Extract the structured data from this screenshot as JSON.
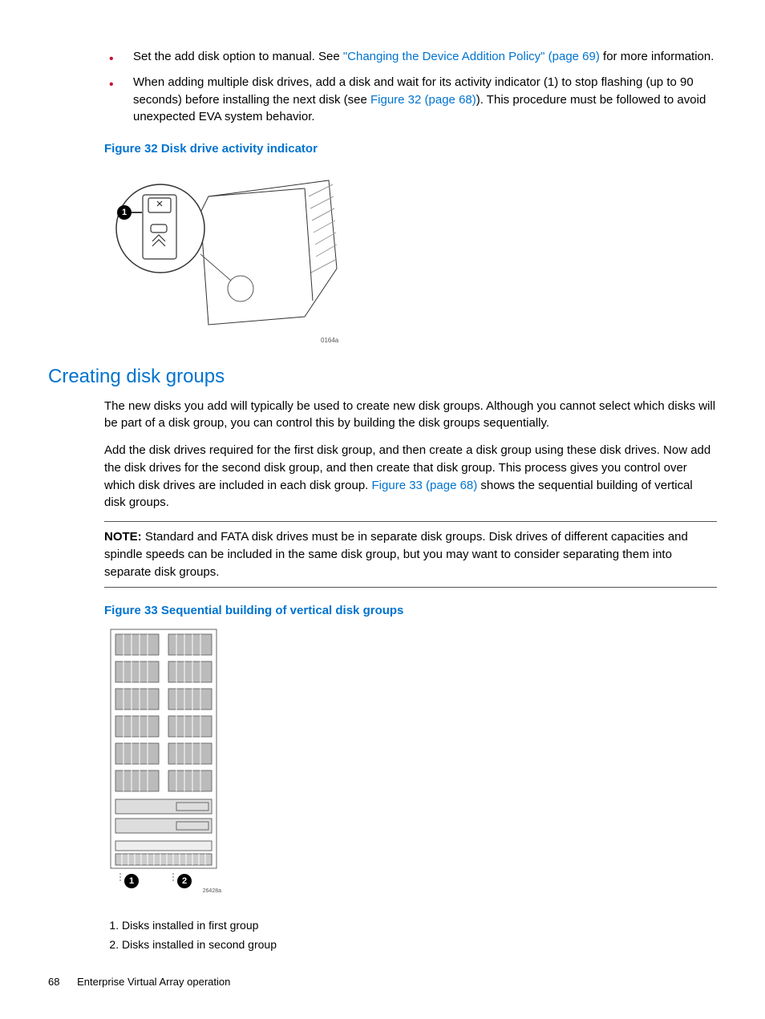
{
  "bullets": [
    {
      "pre": "Set the add disk option to manual. See ",
      "link": "\"Changing the Device Addition Policy\" (page 69)",
      "post": " for more information."
    },
    {
      "pre": "When adding multiple disk drives, add a disk and wait for its activity indicator (1) to stop flashing (up to 90 seconds) before installing the next disk (see ",
      "link": "Figure 32 (page 68)",
      "post": "). This procedure must be followed to avoid unexpected EVA system behavior."
    }
  ],
  "fig32": {
    "caption": "Figure 32 Disk drive activity indicator",
    "image_label": "0164a"
  },
  "section_heading": "Creating disk groups",
  "para1": "The new disks you add will typically be used to create new disk groups. Although you cannot select which disks will be part of a disk group, you can control this by building the disk groups sequentially.",
  "para2": {
    "pre": "Add the disk drives required for the first disk group, and then create a disk group using these disk drives. Now add the disk drives for the second disk group, and then create that disk group. This process gives you control over which disk drives are included in each disk group. ",
    "link": "Figure 33 (page 68)",
    "post": " shows the sequential building of vertical disk groups."
  },
  "note": {
    "label": "NOTE:",
    "text": "    Standard and FATA disk drives must be in separate disk groups. Disk drives of different capacities and spindle speeds can be included in the same disk group, but you may want to consider separating them into separate disk groups."
  },
  "fig33": {
    "caption": "Figure 33 Sequential building of vertical disk groups",
    "image_label": "26428a",
    "legend": [
      "Disks installed in first group",
      "Disks installed in second group"
    ]
  },
  "footer": {
    "page": "68",
    "title": "Enterprise Virtual Array operation"
  }
}
